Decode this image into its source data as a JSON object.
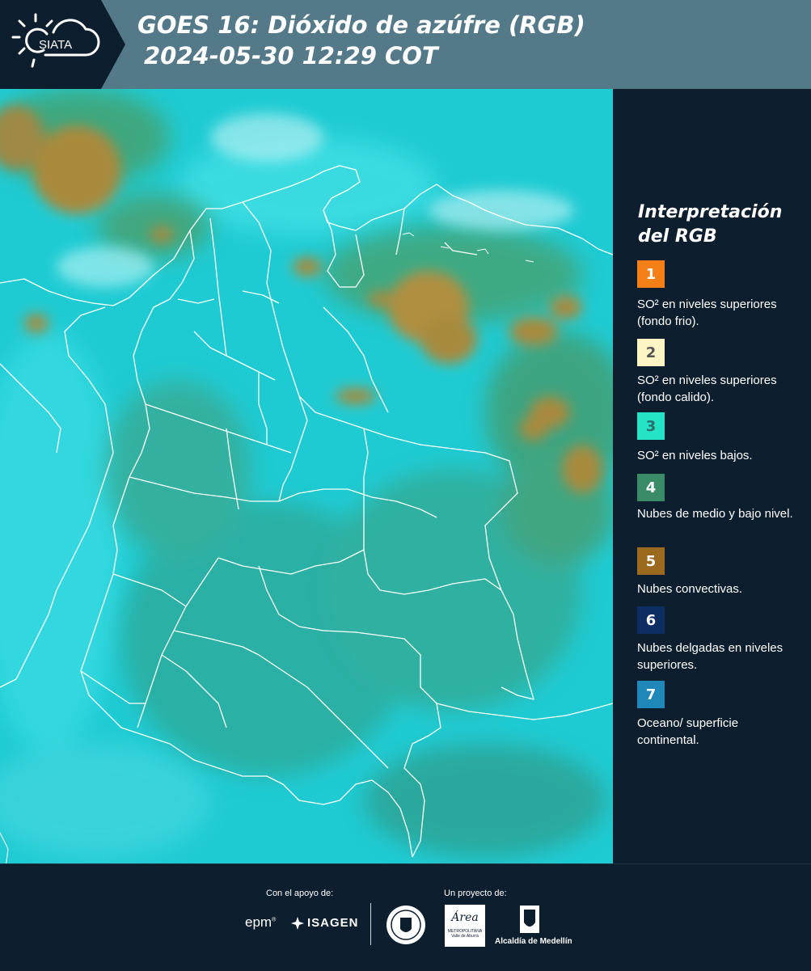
{
  "header": {
    "logo_text": "SIATA",
    "title": "GOES 16: Dióxido de azúfre (RGB)",
    "datetime": "2024-05-30 12:29 COT"
  },
  "map": {
    "product": "Sulfur dioxide RGB satellite composite over Colombia",
    "colors": {
      "background": "#1fcbd3",
      "land_green": "#3f9c6e",
      "convective": "#a8873a",
      "borders": "#ffffff"
    }
  },
  "legend": {
    "title": "Interpretación del RGB",
    "items": [
      {
        "number": "1",
        "color": "#f57f17",
        "text_color": "#ffffff",
        "description": "SO² en niveles superiores (fondo frio)."
      },
      {
        "number": "2",
        "color": "#fdf5c4",
        "text_color": "#555555",
        "description": "SO² en niveles superiores (fondo calido)."
      },
      {
        "number": "3",
        "color": "#25e3c5",
        "text_color": "#2b6f6f",
        "description": "SO² en niveles bajos."
      },
      {
        "number": "4",
        "color": "#3a8c68",
        "text_color": "#ffffff",
        "description": "Nubes de medio y bajo nivel."
      },
      {
        "number": "5",
        "color": "#9c6a1e",
        "text_color": "#ffffff",
        "description": "Nubes convectivas."
      },
      {
        "number": "6",
        "color": "#0d2d63",
        "text_color": "#ffffff",
        "description": "Nubes delgadas en niveles superiores."
      },
      {
        "number": "7",
        "color": "#1e88b8",
        "text_color": "#ffffff",
        "description": "Oceano/ superficie continental."
      }
    ]
  },
  "footer": {
    "support_label": "Con el apoyo de:",
    "project_label": "Un proyecto de:",
    "epm": "epm",
    "isagen": "ISAGEN",
    "area_logo": "Área",
    "area_logo_sub": "METROPOLITANA Valle de Aburrá",
    "alcaldia": "Alcaldía de Medellín"
  }
}
